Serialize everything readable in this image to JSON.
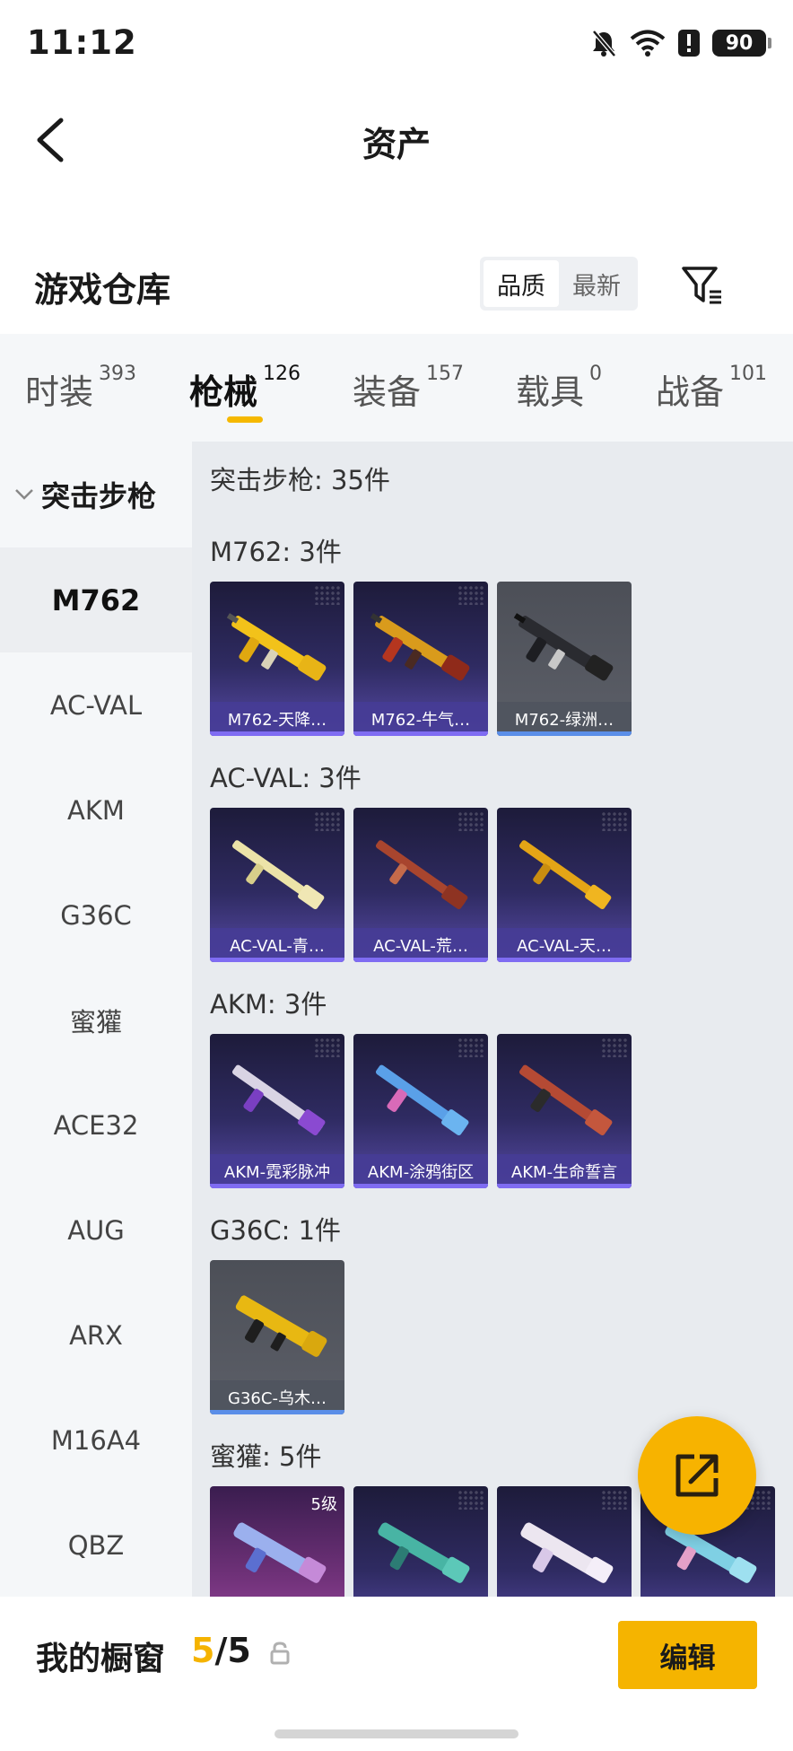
{
  "status_bar": {
    "time": "11:12",
    "battery": "90"
  },
  "nav": {
    "title": "资产"
  },
  "warehouse": {
    "title": "游戏仓库",
    "sort_options": [
      "品质",
      "最新"
    ]
  },
  "tabs": [
    {
      "label": "时装",
      "count": "393"
    },
    {
      "label": "枪械",
      "count": "126"
    },
    {
      "label": "装备",
      "count": "157"
    },
    {
      "label": "载具",
      "count": "0"
    },
    {
      "label": "战备",
      "count": "101"
    }
  ],
  "sidebar": {
    "category": "突击步枪",
    "items": [
      "M762",
      "AC-VAL",
      "AKM",
      "G36C",
      "蜜獾",
      "ACE32",
      "AUG",
      "ARX",
      "M16A4",
      "QBZ"
    ]
  },
  "content": {
    "summary": "突击步枪: 35件",
    "groups": [
      {
        "title": "M762: 3件",
        "items": [
          "M762-天降…",
          "M762-牛气…",
          "M762-绿洲…"
        ]
      },
      {
        "title": "AC-VAL: 3件",
        "items": [
          "AC-VAL-青…",
          "AC-VAL-荒…",
          "AC-VAL-天…"
        ]
      },
      {
        "title": "AKM: 3件",
        "items": [
          "AKM-霓彩脉冲",
          "AKM-涂鸦街区",
          "AKM-生命誓言"
        ]
      },
      {
        "title": "G36C: 1件",
        "items": [
          "G36C-乌木…"
        ]
      },
      {
        "title": "蜜獾: 5件",
        "items": [
          "",
          "",
          "",
          ""
        ],
        "badge": "5级"
      }
    ]
  },
  "showcase": {
    "label": "我的橱窗",
    "current": "5",
    "separator": "/",
    "total": "5"
  },
  "edit_label": "编辑",
  "colors": {
    "accent": "#f5b400",
    "card_purple": "#574aa6",
    "card_gray": "#5c5f68"
  }
}
